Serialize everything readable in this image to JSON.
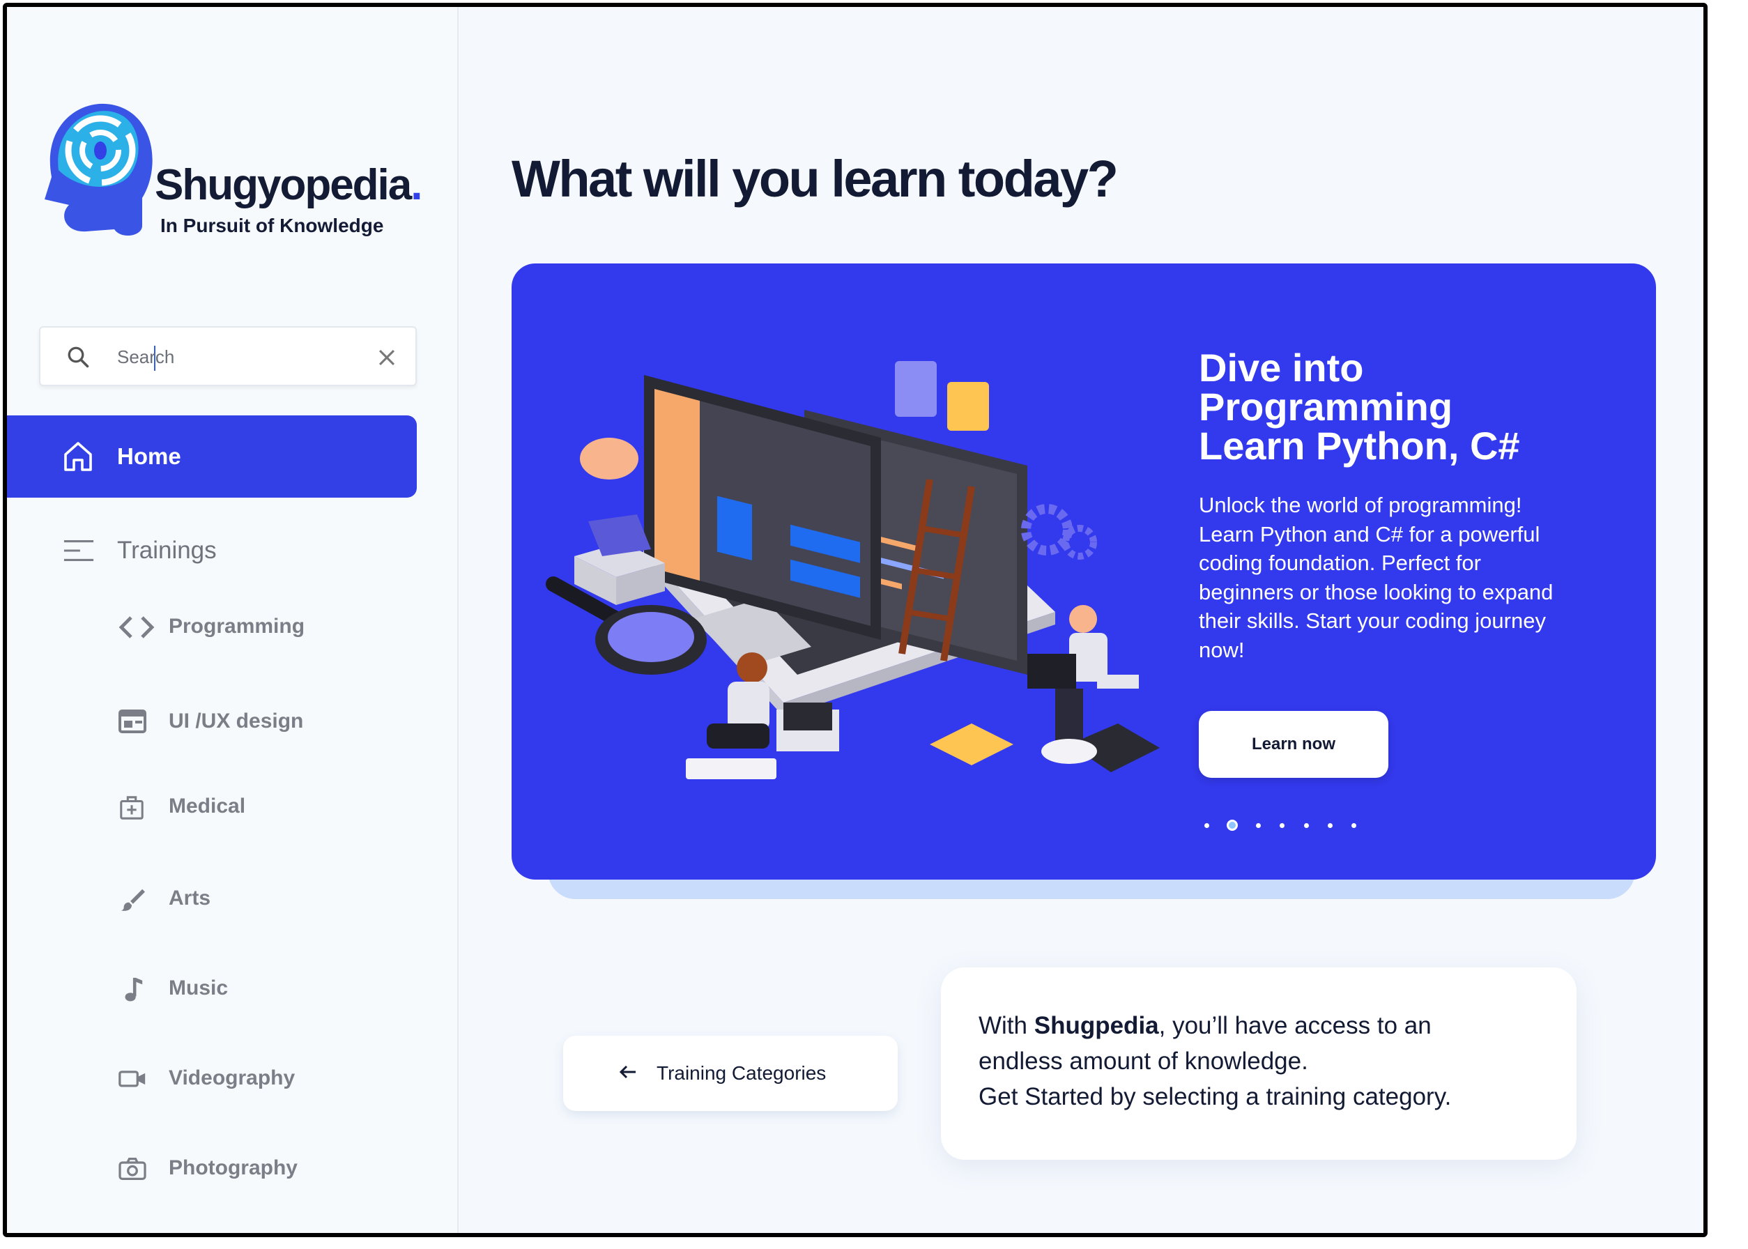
{
  "brand": {
    "name": "Shugyopedia",
    "name_dot": ".",
    "tagline": "In Pursuit of Knowledge",
    "color": "#3341e8"
  },
  "search": {
    "placeholder": "Search",
    "value": ""
  },
  "nav": {
    "home": {
      "label": "Home",
      "icon": "home-icon",
      "active": true
    },
    "trainings": {
      "label": "Trainings",
      "icon": "menu-lines-icon"
    },
    "categories": [
      {
        "label": "Programming",
        "icon": "code-brackets-icon"
      },
      {
        "label": "UI /UX design",
        "icon": "layout-icon"
      },
      {
        "label": "Medical",
        "icon": "medical-kit-icon"
      },
      {
        "label": "Arts",
        "icon": "brush-icon"
      },
      {
        "label": "Music",
        "icon": "music-note-icon"
      },
      {
        "label": "Videography",
        "icon": "video-camera-icon"
      },
      {
        "label": "Photography",
        "icon": "camera-icon"
      }
    ]
  },
  "main": {
    "title": "What will you learn today?",
    "hero": {
      "title_lines": [
        "Dive into",
        "Programming",
        "Learn Python, C#"
      ],
      "description": "Unlock the world of programming! Learn Python and C# for a powerful coding foundation. Perfect for beginners or those looking to expand their skills. Start your coding journey now!",
      "button": "Learn now",
      "slide_count": 7,
      "active_slide": 2,
      "background": "#3339ec"
    },
    "categories_button": "Training Categories",
    "info": {
      "prefix": "With ",
      "brand": "Shugpedia",
      "rest_line1": ", you’ll have access to an",
      "line2": "endless amount of knowledge.",
      "line3": "Get Started by selecting a training category."
    }
  }
}
